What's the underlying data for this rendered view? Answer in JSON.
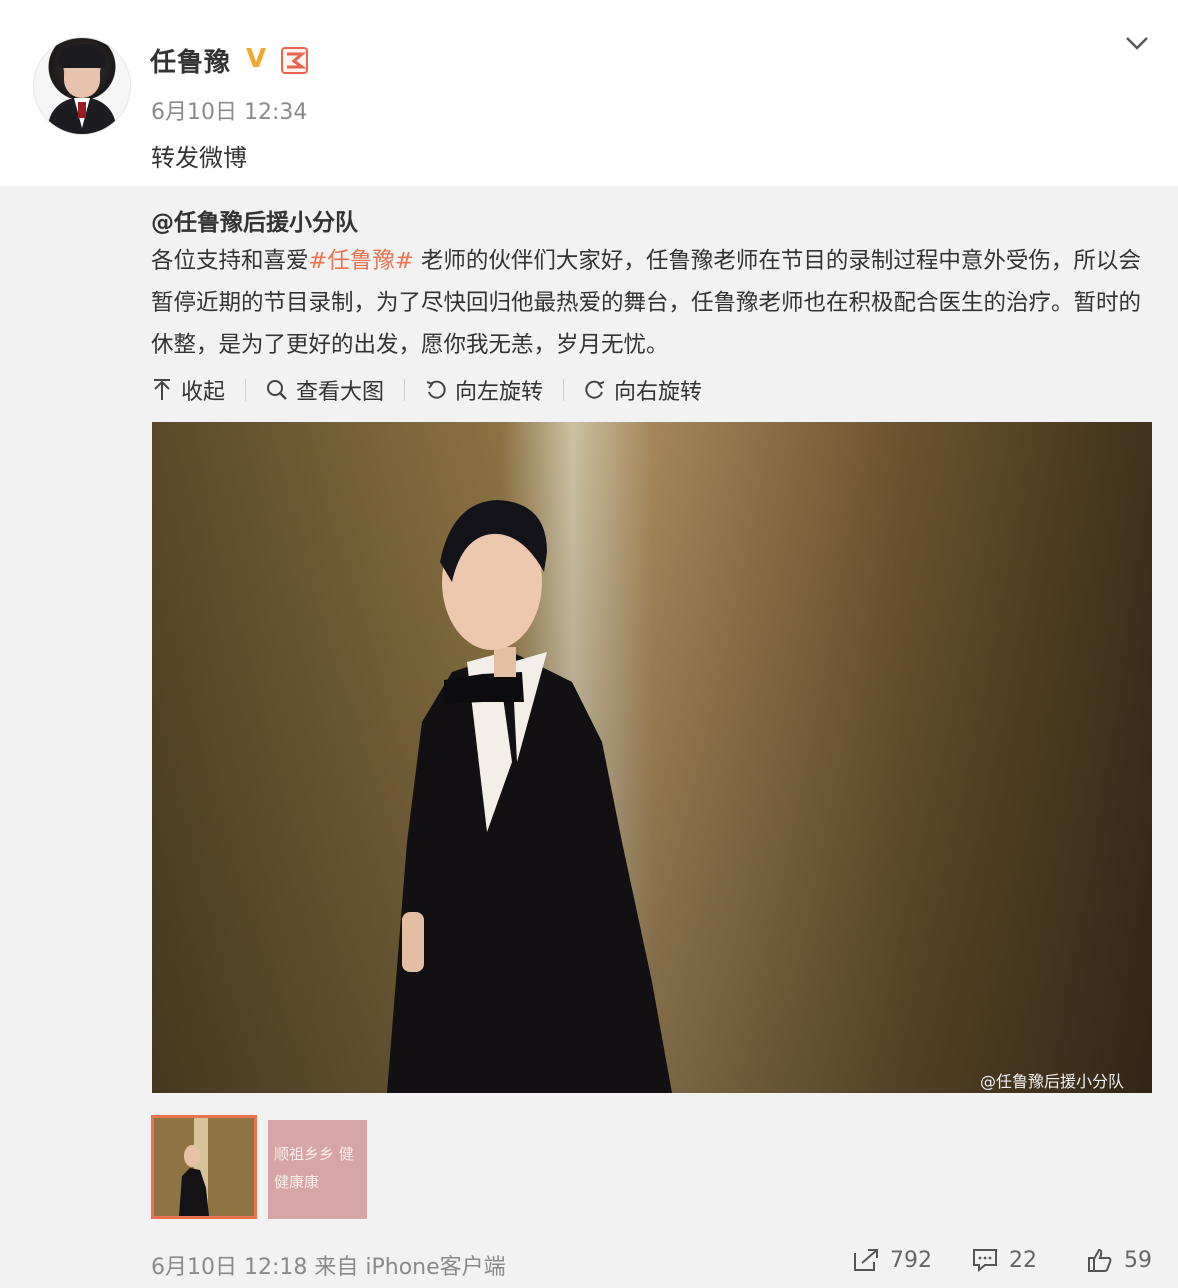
{
  "post": {
    "username": "任鲁豫",
    "verified_mark": "V",
    "time": "6月10日 12:34",
    "text": "转发微博"
  },
  "repost": {
    "author": "@任鲁豫后援小分队",
    "body_before": "各位支持和喜爱",
    "hashtag": "#任鲁豫#",
    "body_after": " 老师的伙伴们大家好，任鲁豫老师在节目的录制过程中意外受伤，所以会暂停近期的节目录制，为了尽快回归他最热爱的舞台，任鲁豫老师也在积极配合医生的治疗。暂时的休整，是为了更好的出发，愿你我无恙，岁月无忧。",
    "actions": {
      "collapse": "收起",
      "view_large": "查看大图",
      "rotate_left": "向左旋转",
      "rotate_right": "向右旋转"
    },
    "image_watermark": "@任鲁豫后援小分队",
    "thumb2_text": "顺祖乡乡 健健康康",
    "meta": {
      "time_source": "6月10日 12:18 来自 iPhone客户端",
      "reposts": "792",
      "comments": "22",
      "likes": "59"
    }
  },
  "colors": {
    "hashtag": "#eb7350",
    "thumb_selected_border": "#eb7350",
    "verified": "#f2a92b"
  }
}
